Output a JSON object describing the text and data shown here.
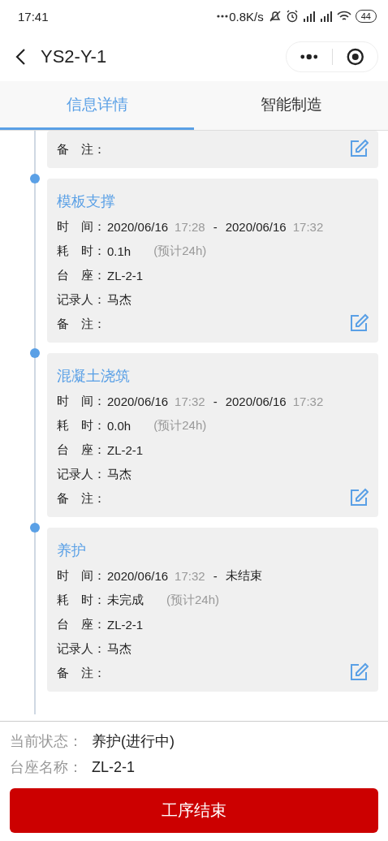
{
  "status_bar": {
    "time": "17:41",
    "speed": "0.8K/s",
    "battery": "44"
  },
  "header": {
    "title": "YS2-Y-1"
  },
  "tabs": [
    {
      "label": "信息详情",
      "selected": true
    },
    {
      "label": "智能制造",
      "selected": false
    }
  ],
  "timeline": [
    {
      "rows": [
        {
          "kind": "text",
          "label": "备　注："
        }
      ]
    },
    {
      "title": "模板支撑",
      "rows": [
        {
          "kind": "time",
          "label": "时　间：",
          "start_date": "2020/06/16",
          "start_time": "17:28",
          "separator": "-",
          "end_date": "2020/06/16",
          "end_time": "17:32"
        },
        {
          "kind": "duration",
          "label": "耗　时：",
          "value": "0.1h",
          "estimate": "(预计24h)"
        },
        {
          "kind": "text",
          "label": "台　座：",
          "value": "ZL-2-1"
        },
        {
          "kind": "text",
          "label": "记录人：",
          "value": "马杰"
        },
        {
          "kind": "text",
          "label": "备　注："
        }
      ]
    },
    {
      "title": "混凝土浇筑",
      "rows": [
        {
          "kind": "time",
          "label": "时　间：",
          "start_date": "2020/06/16",
          "start_time": "17:32",
          "separator": "-",
          "end_date": "2020/06/16",
          "end_time": "17:32"
        },
        {
          "kind": "duration",
          "label": "耗　时：",
          "value": "0.0h",
          "estimate": "(预计24h)"
        },
        {
          "kind": "text",
          "label": "台　座：",
          "value": "ZL-2-1"
        },
        {
          "kind": "text",
          "label": "记录人：",
          "value": "马杰"
        },
        {
          "kind": "text",
          "label": "备　注："
        }
      ]
    },
    {
      "title": "养护",
      "rows": [
        {
          "kind": "time",
          "label": "时　间：",
          "start_date": "2020/06/16",
          "start_time": "17:32",
          "separator": "-",
          "end_date": "未结束"
        },
        {
          "kind": "duration",
          "label": "耗　时：",
          "value": "未完成",
          "estimate": "(预计24h)"
        },
        {
          "kind": "text",
          "label": "台　座：",
          "value": "ZL-2-1"
        },
        {
          "kind": "text",
          "label": "记录人：",
          "value": "马杰"
        },
        {
          "kind": "text",
          "label": "备　注："
        }
      ]
    }
  ],
  "summary": [
    {
      "label": "当前状态：",
      "value": "养护(进行中)"
    },
    {
      "label": "台座名称：",
      "value": "ZL-2-1"
    }
  ],
  "action_button": "工序结束"
}
